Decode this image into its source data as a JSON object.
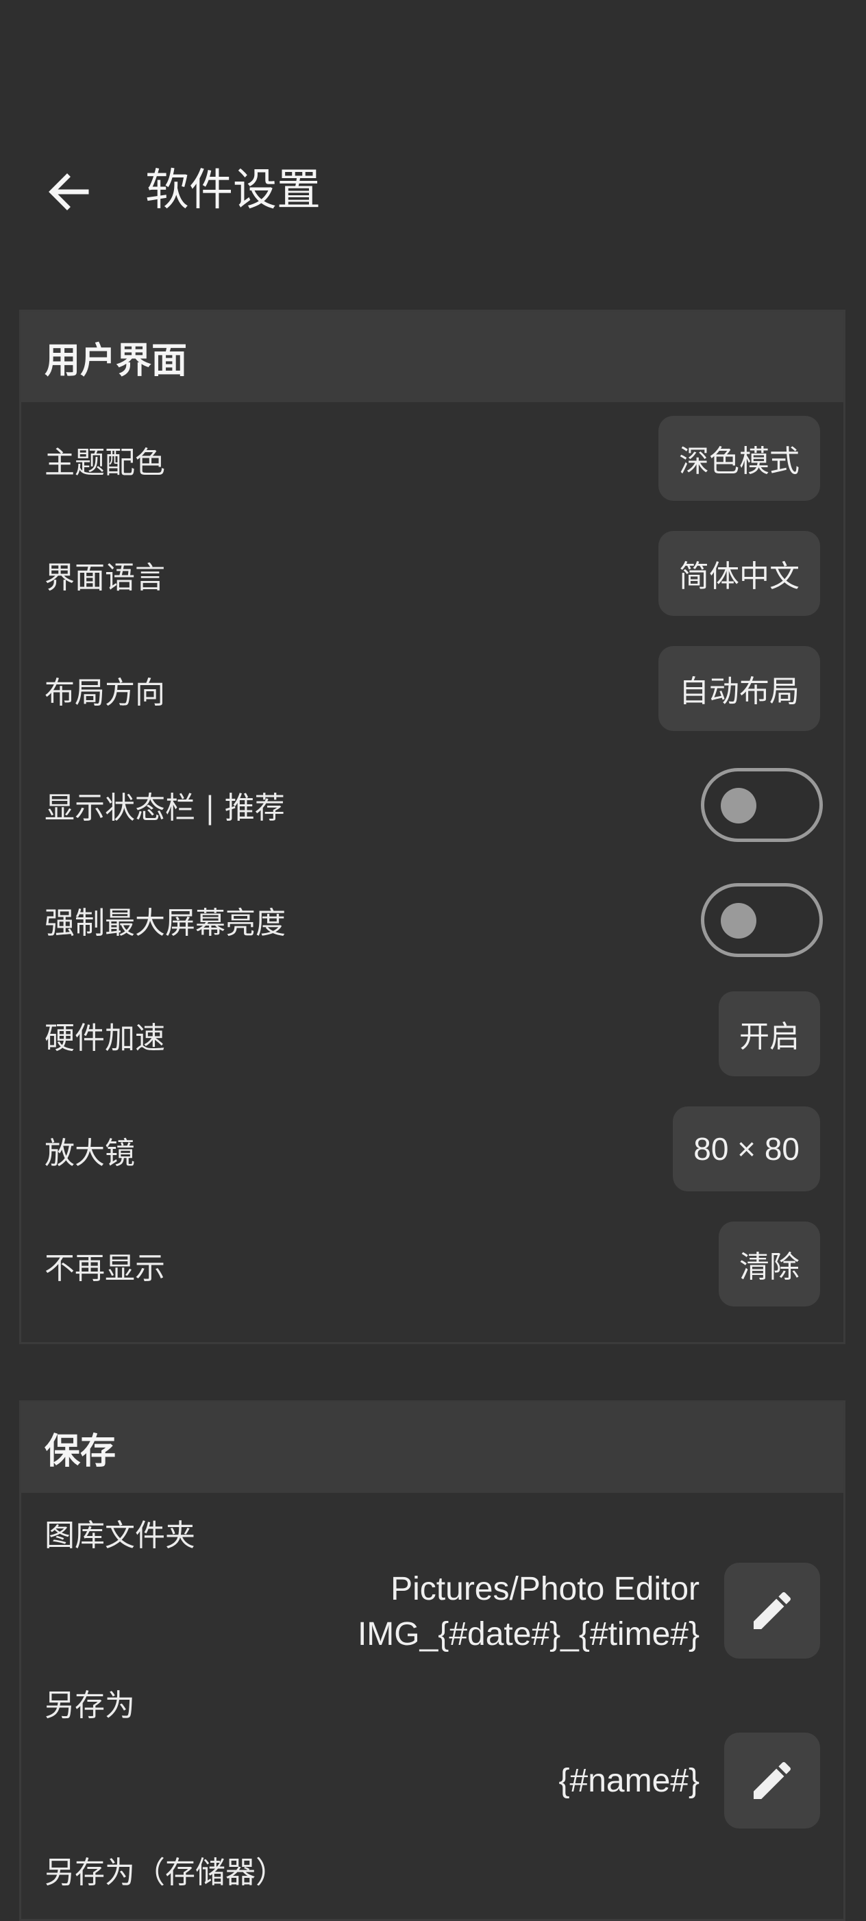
{
  "header": {
    "title": "软件设置",
    "back_icon": "arrow-left-icon"
  },
  "ui_section": {
    "title": "用户界面",
    "rows": [
      {
        "label": "主题配色",
        "control": "chip",
        "value": "深色模式"
      },
      {
        "label": "界面语言",
        "control": "chip",
        "value": "简体中文"
      },
      {
        "label": "布局方向",
        "control": "chip",
        "value": "自动布局"
      },
      {
        "label": "显示状态栏 | 推荐",
        "control": "switch",
        "checked": false
      },
      {
        "label": "强制最大屏幕亮度",
        "control": "switch",
        "checked": false
      },
      {
        "label": "硬件加速",
        "control": "chip",
        "value": "开启"
      },
      {
        "label": "放大镜",
        "control": "chip",
        "value": "80 × 80"
      },
      {
        "label": "不再显示",
        "control": "chip",
        "value": "清除"
      }
    ]
  },
  "save_section": {
    "title": "保存",
    "gallery_folder": {
      "label": "图库文件夹",
      "line1": "Pictures/Photo Editor",
      "line2": "IMG_{#date#}_{#time#}",
      "edit_icon": "pencil-icon"
    },
    "save_as": {
      "label": "另存为",
      "value": "{#name#}",
      "edit_icon": "pencil-icon"
    },
    "save_as_storage": {
      "label": "另存为（存储器）"
    }
  },
  "colors": {
    "background": "#2f2f2f",
    "card_header": "#3c3c3c",
    "chip": "#414141",
    "switch_off": "#9a9a9a"
  }
}
